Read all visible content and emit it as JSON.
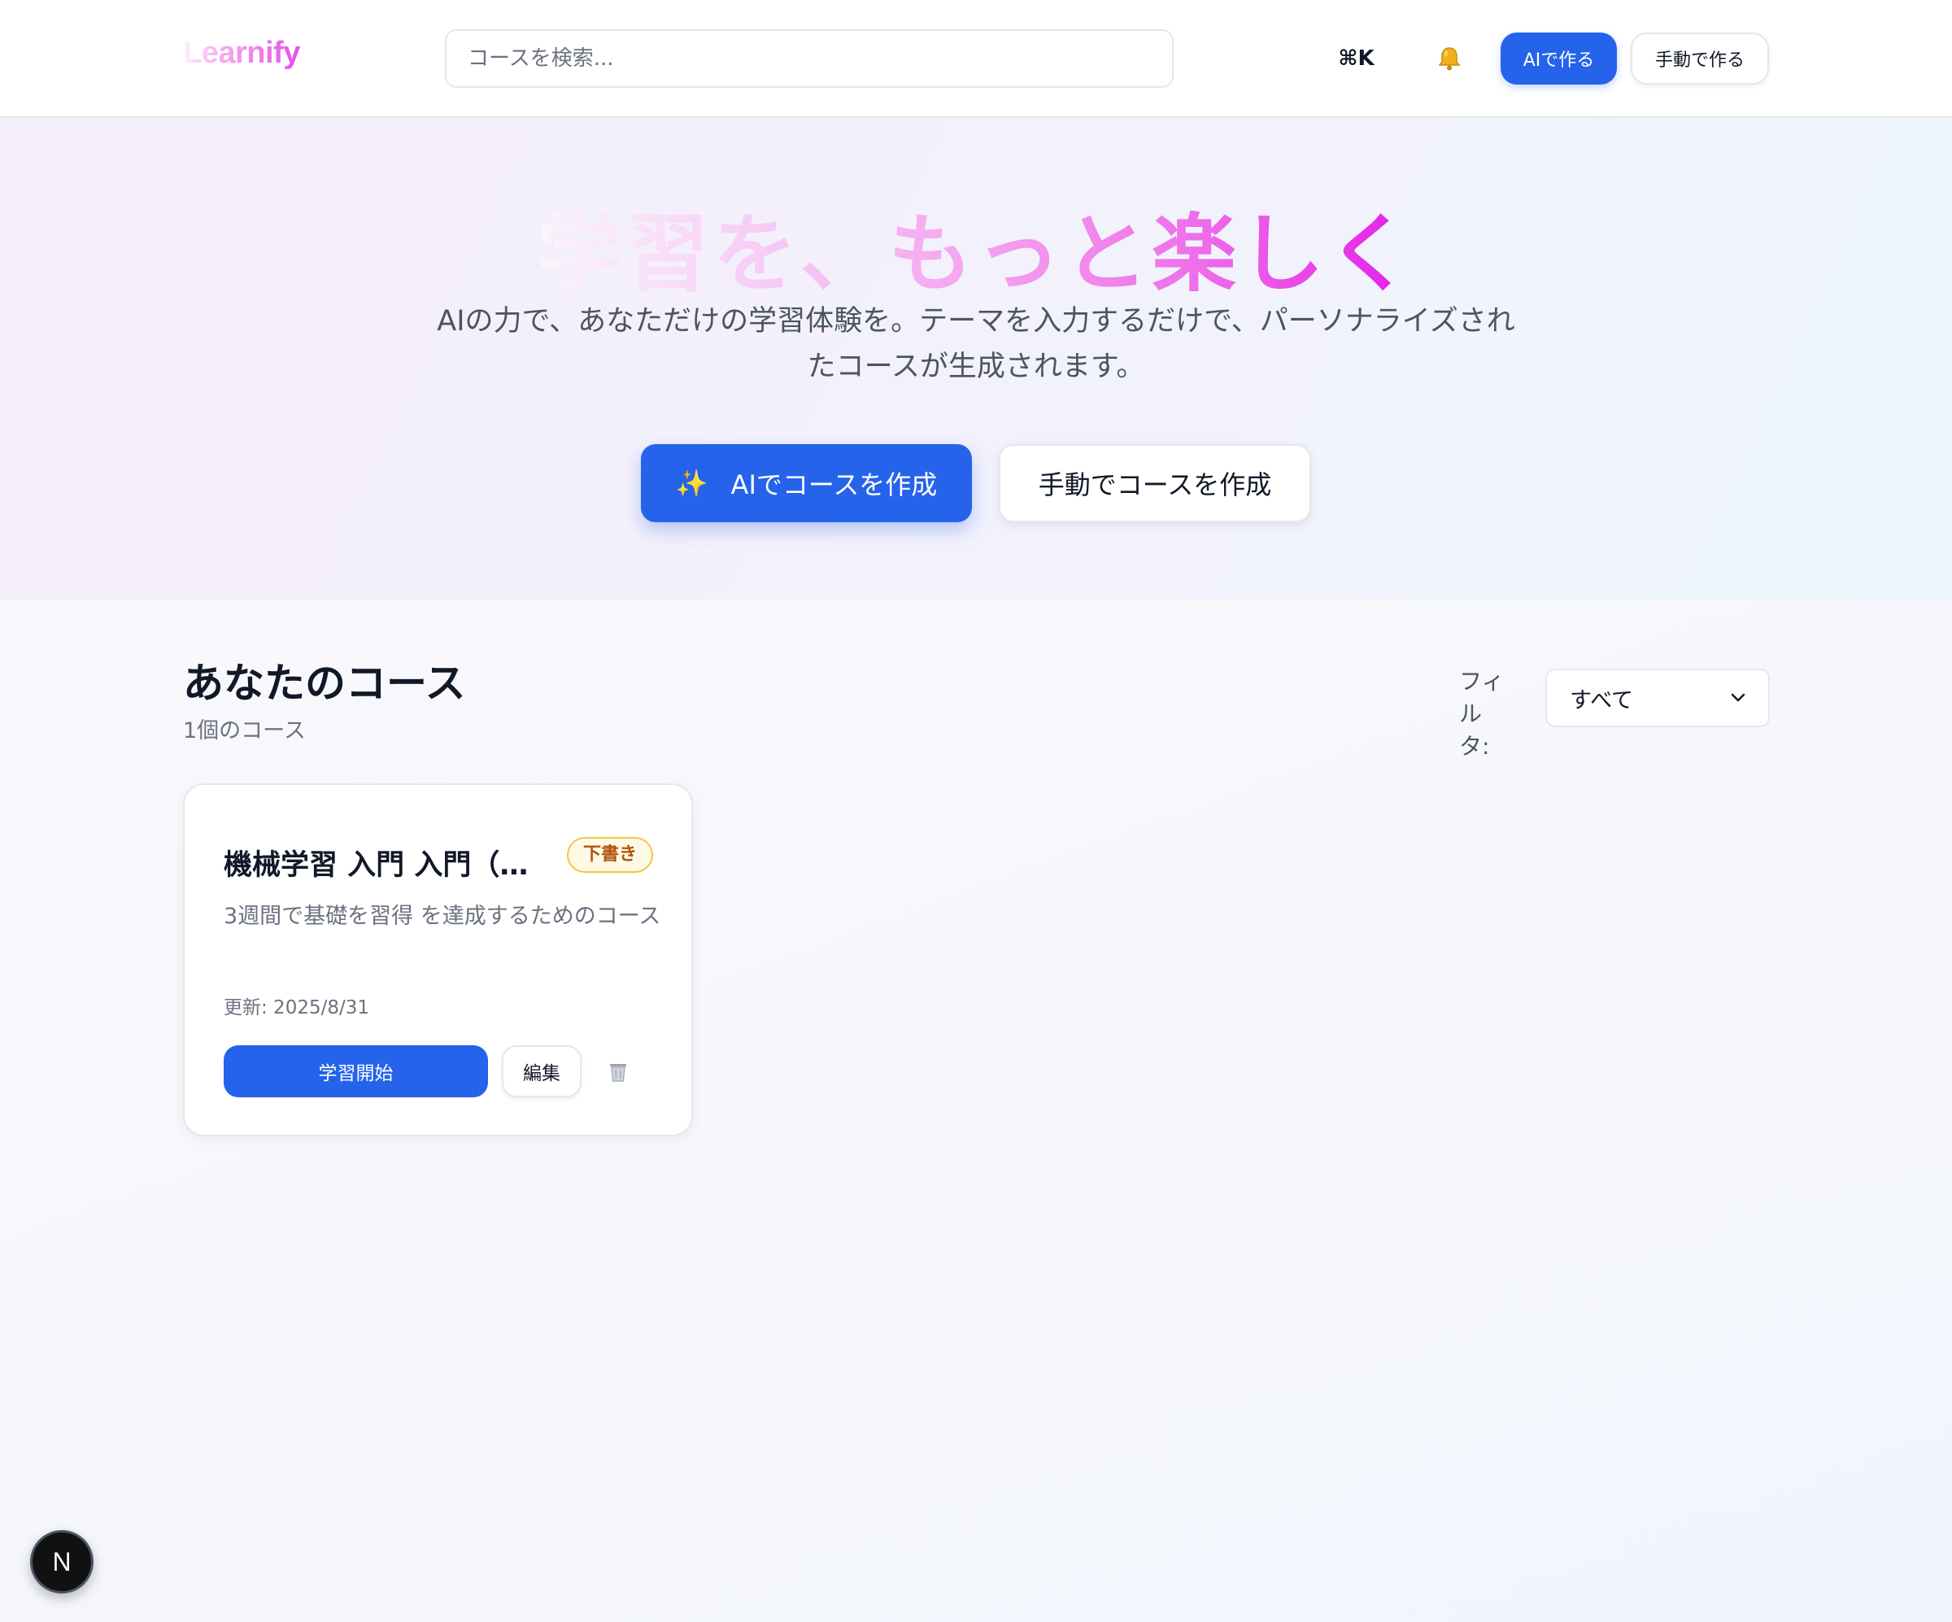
{
  "header": {
    "logo": "Learnify",
    "search_placeholder": "コースを検索...",
    "shortcut": "⌘K",
    "ai_create_label": "AIで作る",
    "manual_create_label": "手動で作る"
  },
  "hero": {
    "title": "学習を、もっと楽しく",
    "subtitle": "AIの力で、あなただけの学習体験を。テーマを入力するだけで、パーソナライズされたコースが生成されます。",
    "ai_button_icon": "✨",
    "ai_button_label": "AIでコースを作成",
    "manual_button_label": "手動でコースを作成"
  },
  "courses": {
    "title": "あなたのコース",
    "count": "1個のコース",
    "filter_label": "フィルタ:",
    "filter_value": "すべて",
    "items": [
      {
        "title": "機械学習 入門 入門（初級）",
        "status": "下書き",
        "description": "3週間で基礎を習得 を達成するためのコース",
        "updated": "更新: 2025/8/31",
        "start_label": "学習開始",
        "edit_label": "編集"
      }
    ]
  },
  "dev_badge": "N",
  "colors": {
    "primary": "#2563eb",
    "brand_gradient_end": "#e31ee8",
    "draft_badge": "#b45309"
  }
}
